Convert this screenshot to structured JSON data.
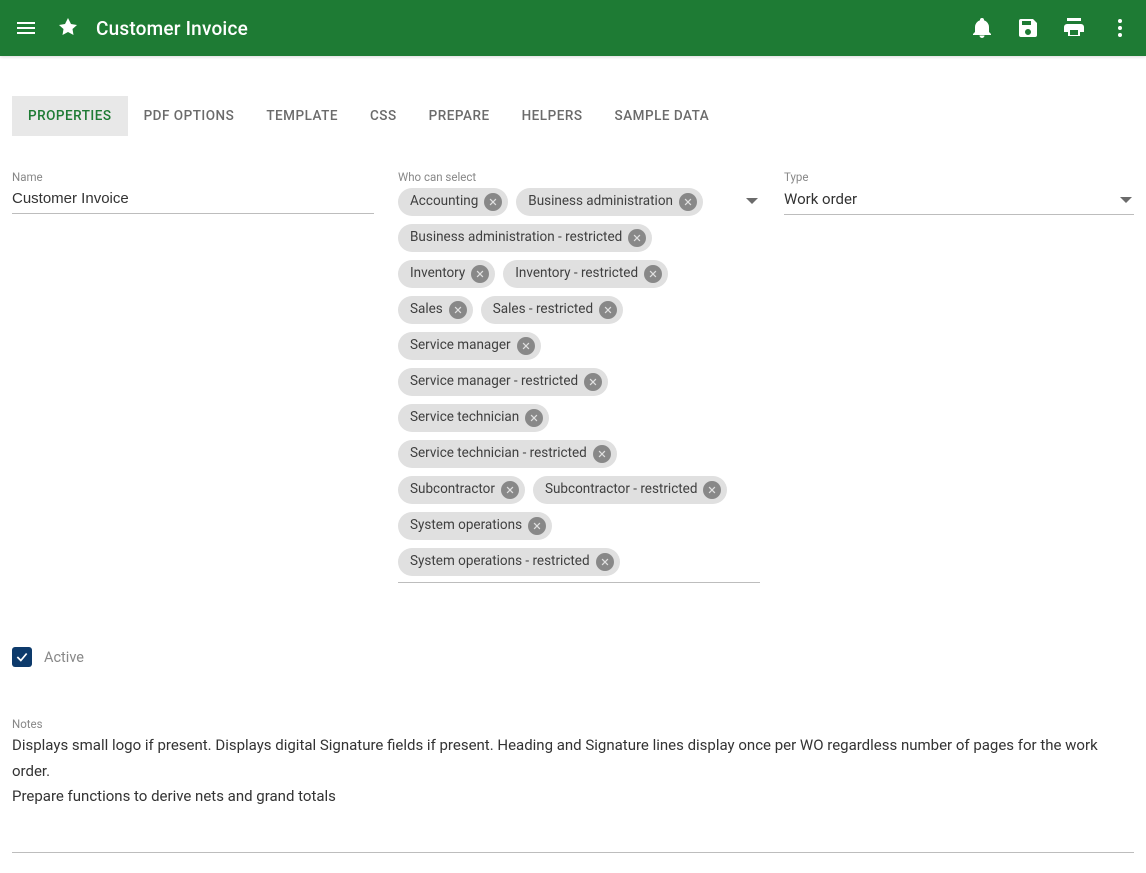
{
  "header": {
    "title": "Customer Invoice"
  },
  "tabs": [
    {
      "label": "PROPERTIES",
      "active": true
    },
    {
      "label": "PDF OPTIONS",
      "active": false
    },
    {
      "label": "TEMPLATE",
      "active": false
    },
    {
      "label": "CSS",
      "active": false
    },
    {
      "label": "PREPARE",
      "active": false
    },
    {
      "label": "HELPERS",
      "active": false
    },
    {
      "label": "SAMPLE DATA",
      "active": false
    }
  ],
  "form": {
    "name_label": "Name",
    "name_value": "Customer Invoice",
    "who_label": "Who can select",
    "who_chips": [
      "Accounting",
      "Business administration",
      "Business administration - restricted",
      "Inventory",
      "Inventory - restricted",
      "Sales",
      "Sales - restricted",
      "Service manager",
      "Service manager - restricted",
      "Service technician",
      "Service technician - restricted",
      "Subcontractor",
      "Subcontractor - restricted",
      "System operations",
      "System operations - restricted"
    ],
    "type_label": "Type",
    "type_value": "Work order",
    "active_label": "Active",
    "active_checked": true,
    "notes_label": "Notes",
    "notes_value": "Displays small logo if present. Displays digital Signature fields if present. Heading and Signature lines display once per WO regardless number of pages for the work order.\nPrepare functions to derive nets and grand totals"
  }
}
